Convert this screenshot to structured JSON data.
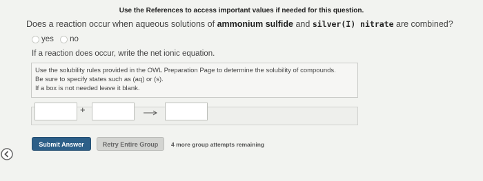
{
  "header": {
    "note": "Use the References to access important values if needed for this question."
  },
  "question": {
    "prefix": "Does a reaction occur when aqueous solutions of ",
    "reactant1": "ammonium sulfide",
    "middle": " and ",
    "reactant2": "silver(I) nitrate",
    "suffix": " are combined?"
  },
  "options": {
    "yes": "yes",
    "no": "no"
  },
  "instruction": "If a reaction does occur, write the net ionic equation.",
  "rules": [
    "Use the solubility rules provided in the OWL Preparation Page to determine the solubility of compounds.",
    "Be sure to specify states such as (aq) or (s).",
    "If a box is not needed leave it blank."
  ],
  "equation": {
    "plus": "+"
  },
  "buttons": {
    "submit": "Submit Answer",
    "retry": "Retry Entire Group"
  },
  "status": {
    "remaining": "4 more group attempts remaining"
  }
}
